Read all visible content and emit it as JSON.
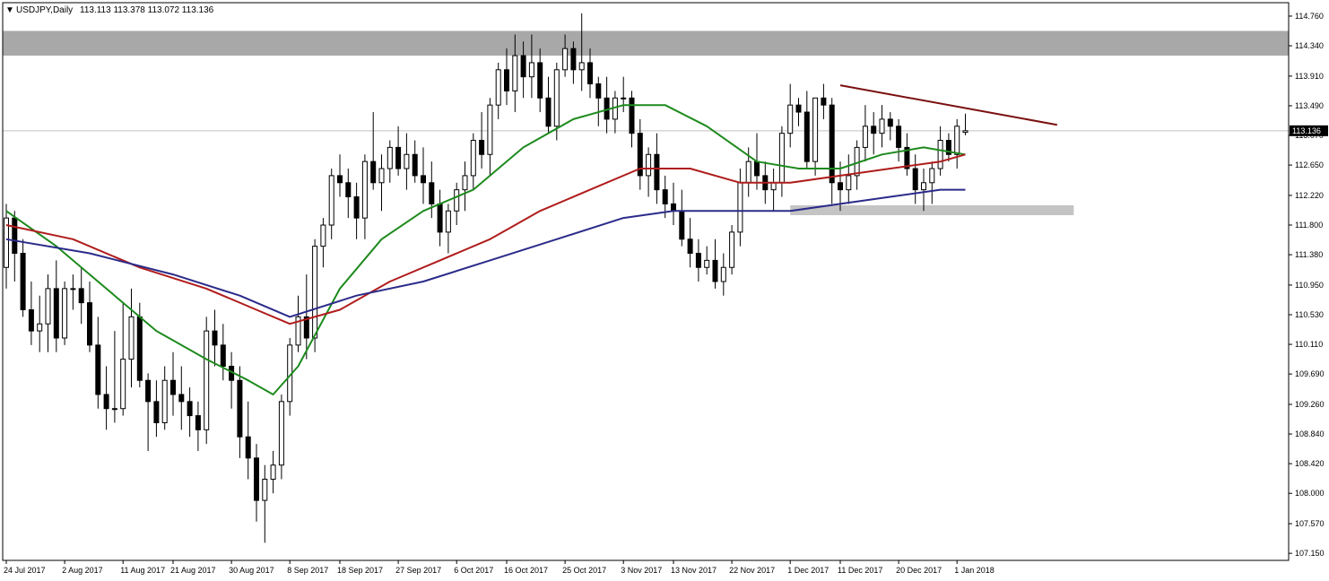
{
  "header": {
    "symbol_label": "USDJPY,Daily",
    "ohlc_label": "113.113 113.378 113.072 113.136"
  },
  "colors": {
    "background": "#ffffff",
    "candle_up_body": "#ffffff",
    "candle_down_body": "#000000",
    "candle_outline": "#000000",
    "ma_fast": "#1d8a1d",
    "ma_mid": "#b01c1c",
    "ma_slow": "#2b2b8a",
    "resistance_zone": "#a8a8a8",
    "support_zone": "#c4c4c4",
    "trendline": "#7a0f0f",
    "current_price_line": "#c0c0c0",
    "price_box": "#000000"
  },
  "chart_data": {
    "type": "candlestick",
    "symbol": "USDJPY",
    "timeframe": "Daily",
    "current_price": 113.136,
    "ohlc_last": {
      "open": 113.113,
      "high": 113.378,
      "low": 113.072,
      "close": 113.136
    },
    "ylim": [
      107.05,
      114.95
    ],
    "y_ticks": [
      "114.760",
      "114.340",
      "113.910",
      "113.490",
      "113.070",
      "112.650",
      "112.220",
      "111.800",
      "111.380",
      "110.950",
      "110.530",
      "110.110",
      "109.690",
      "109.260",
      "108.840",
      "108.420",
      "108.000",
      "107.570",
      "107.150"
    ],
    "x_ticks": [
      {
        "label": "24 Jul 2017",
        "index": 0
      },
      {
        "label": "2 Aug 2017",
        "index": 7
      },
      {
        "label": "11 Aug 2017",
        "index": 14
      },
      {
        "label": "21 Aug 2017",
        "index": 20
      },
      {
        "label": "30 Aug 2017",
        "index": 27
      },
      {
        "label": "8 Sep 2017",
        "index": 34
      },
      {
        "label": "18 Sep 2017",
        "index": 40
      },
      {
        "label": "27 Sep 2017",
        "index": 47
      },
      {
        "label": "6 Oct 2017",
        "index": 54
      },
      {
        "label": "16 Oct 2017",
        "index": 60
      },
      {
        "label": "25 Oct 2017",
        "index": 67
      },
      {
        "label": "3 Nov 2017",
        "index": 74
      },
      {
        "label": "13 Nov 2017",
        "index": 80
      },
      {
        "label": "22 Nov 2017",
        "index": 87
      },
      {
        "label": "1 Dec 2017",
        "index": 94
      },
      {
        "label": "11 Dec 2017",
        "index": 100
      },
      {
        "label": "20 Dec 2017",
        "index": 107
      },
      {
        "label": "1 Jan 2018",
        "index": 114
      }
    ],
    "candles": [
      [
        111.2,
        112.1,
        110.9,
        111.9
      ],
      [
        111.9,
        112.0,
        111.0,
        111.4
      ],
      [
        111.4,
        111.6,
        110.5,
        110.6
      ],
      [
        110.6,
        111.0,
        110.1,
        110.3
      ],
      [
        110.3,
        110.8,
        110.0,
        110.4
      ],
      [
        110.4,
        111.1,
        110.0,
        110.9
      ],
      [
        110.9,
        111.3,
        110.0,
        110.2
      ],
      [
        110.2,
        111.0,
        110.1,
        110.9
      ],
      [
        110.9,
        111.1,
        110.6,
        110.9
      ],
      [
        110.9,
        111.2,
        110.4,
        110.7
      ],
      [
        110.7,
        111.0,
        110.0,
        110.1
      ],
      [
        110.1,
        110.5,
        109.2,
        109.4
      ],
      [
        109.4,
        109.8,
        108.9,
        109.2
      ],
      [
        109.2,
        110.3,
        109.0,
        109.2
      ],
      [
        109.2,
        110.7,
        109.1,
        109.9
      ],
      [
        109.9,
        110.9,
        109.5,
        110.5
      ],
      [
        110.5,
        110.7,
        109.5,
        109.6
      ],
      [
        109.6,
        109.7,
        108.6,
        109.3
      ],
      [
        109.3,
        109.6,
        108.8,
        109.0
      ],
      [
        109.0,
        109.8,
        108.9,
        109.6
      ],
      [
        109.6,
        110.0,
        109.1,
        109.4
      ],
      [
        109.4,
        109.8,
        108.9,
        109.3
      ],
      [
        109.3,
        109.5,
        108.8,
        109.1
      ],
      [
        109.1,
        109.3,
        108.6,
        108.9
      ],
      [
        108.9,
        110.5,
        108.7,
        110.3
      ],
      [
        110.3,
        110.6,
        109.8,
        110.1
      ],
      [
        110.1,
        110.4,
        109.6,
        109.8
      ],
      [
        109.8,
        110.0,
        109.2,
        109.6
      ],
      [
        109.6,
        109.8,
        108.5,
        108.8
      ],
      [
        108.8,
        109.3,
        108.2,
        108.5
      ],
      [
        108.5,
        108.7,
        107.6,
        107.9
      ],
      [
        107.9,
        108.4,
        107.3,
        108.2
      ],
      [
        108.2,
        108.6,
        108.0,
        108.4
      ],
      [
        108.4,
        109.4,
        108.2,
        109.3
      ],
      [
        109.3,
        110.2,
        109.1,
        110.1
      ],
      [
        110.1,
        110.8,
        110.0,
        110.5
      ],
      [
        110.5,
        111.1,
        109.9,
        110.2
      ],
      [
        110.2,
        111.6,
        110.0,
        111.5
      ],
      [
        111.5,
        111.9,
        111.2,
        111.8
      ],
      [
        111.8,
        112.6,
        111.6,
        112.5
      ],
      [
        112.5,
        112.8,
        112.2,
        112.4
      ],
      [
        112.4,
        112.6,
        111.9,
        112.2
      ],
      [
        112.2,
        112.4,
        111.6,
        111.9
      ],
      [
        111.9,
        112.8,
        111.6,
        112.7
      ],
      [
        112.7,
        113.4,
        112.3,
        112.4
      ],
      [
        112.4,
        112.8,
        112.0,
        112.6
      ],
      [
        112.6,
        113.0,
        112.4,
        112.9
      ],
      [
        112.9,
        113.2,
        112.5,
        112.6
      ],
      [
        112.6,
        113.1,
        112.3,
        112.8
      ],
      [
        112.8,
        113.0,
        112.4,
        112.5
      ],
      [
        112.5,
        112.9,
        112.1,
        112.4
      ],
      [
        112.4,
        112.7,
        111.9,
        112.1
      ],
      [
        112.1,
        112.3,
        111.5,
        111.7
      ],
      [
        111.7,
        112.1,
        111.4,
        112.0
      ],
      [
        112.0,
        112.4,
        111.8,
        112.3
      ],
      [
        112.3,
        112.7,
        112.0,
        112.5
      ],
      [
        112.5,
        113.1,
        112.3,
        113.0
      ],
      [
        113.0,
        113.4,
        112.6,
        112.8
      ],
      [
        112.8,
        113.6,
        112.5,
        113.5
      ],
      [
        113.5,
        114.1,
        113.3,
        114.0
      ],
      [
        114.0,
        114.3,
        113.5,
        113.7
      ],
      [
        113.7,
        114.5,
        113.4,
        114.2
      ],
      [
        114.2,
        114.4,
        113.6,
        113.9
      ],
      [
        113.9,
        114.5,
        113.6,
        114.1
      ],
      [
        114.1,
        114.3,
        113.4,
        113.6
      ],
      [
        113.6,
        113.9,
        113.1,
        113.2
      ],
      [
        113.2,
        114.1,
        113.0,
        114.0
      ],
      [
        114.0,
        114.5,
        113.9,
        114.3
      ],
      [
        114.3,
        114.4,
        113.8,
        114.0
      ],
      [
        114.0,
        114.8,
        113.7,
        114.1
      ],
      [
        114.1,
        114.3,
        113.6,
        113.8
      ],
      [
        113.8,
        113.9,
        113.2,
        113.6
      ],
      [
        113.6,
        113.9,
        113.1,
        113.3
      ],
      [
        113.3,
        113.7,
        113.1,
        113.6
      ],
      [
        113.6,
        113.9,
        113.4,
        113.6
      ],
      [
        113.6,
        113.7,
        112.9,
        113.1
      ],
      [
        113.1,
        113.3,
        112.3,
        112.5
      ],
      [
        112.5,
        112.9,
        112.2,
        112.8
      ],
      [
        112.8,
        113.1,
        112.1,
        112.3
      ],
      [
        112.3,
        112.5,
        111.9,
        112.1
      ],
      [
        112.1,
        112.4,
        111.8,
        112.0
      ],
      [
        112.0,
        112.3,
        111.5,
        111.6
      ],
      [
        111.6,
        111.9,
        111.2,
        111.4
      ],
      [
        111.4,
        111.6,
        111.0,
        111.2
      ],
      [
        111.2,
        111.5,
        111.1,
        111.3
      ],
      [
        111.3,
        111.6,
        110.9,
        111.0
      ],
      [
        111.0,
        111.4,
        110.8,
        111.2
      ],
      [
        111.2,
        111.8,
        111.1,
        111.7
      ],
      [
        111.7,
        112.6,
        111.5,
        112.4
      ],
      [
        112.4,
        112.9,
        112.2,
        112.7
      ],
      [
        112.7,
        113.1,
        112.3,
        112.5
      ],
      [
        112.5,
        112.7,
        112.1,
        112.3
      ],
      [
        112.3,
        112.6,
        112.0,
        112.4
      ],
      [
        112.4,
        113.2,
        112.2,
        113.1
      ],
      [
        113.1,
        113.8,
        112.9,
        113.5
      ],
      [
        113.5,
        113.6,
        113.2,
        113.4
      ],
      [
        113.4,
        113.7,
        112.6,
        112.7
      ],
      [
        112.7,
        113.6,
        112.5,
        113.6
      ],
      [
        113.6,
        113.8,
        113.3,
        113.5
      ],
      [
        113.5,
        113.6,
        112.1,
        112.4
      ],
      [
        112.4,
        112.7,
        112.0,
        112.3
      ],
      [
        112.3,
        112.8,
        112.1,
        112.5
      ],
      [
        112.5,
        113.0,
        112.3,
        112.9
      ],
      [
        112.9,
        113.5,
        112.7,
        113.2
      ],
      [
        113.2,
        113.4,
        112.8,
        113.1
      ],
      [
        113.1,
        113.5,
        112.9,
        113.3
      ],
      [
        113.3,
        113.4,
        113.0,
        113.2
      ],
      [
        113.2,
        113.3,
        112.7,
        112.9
      ],
      [
        112.9,
        113.1,
        112.5,
        112.6
      ],
      [
        112.6,
        112.8,
        112.1,
        112.3
      ],
      [
        112.3,
        112.6,
        112.0,
        112.4
      ],
      [
        112.4,
        112.7,
        112.1,
        112.6
      ],
      [
        112.6,
        113.2,
        112.5,
        113.0
      ],
      [
        113.0,
        113.1,
        112.7,
        112.8
      ],
      [
        112.8,
        113.3,
        112.6,
        113.2
      ],
      [
        113.113,
        113.378,
        113.072,
        113.136
      ]
    ],
    "series": [
      {
        "type": "line",
        "color": "#1d8a1d",
        "points": [
          [
            0,
            112.0
          ],
          [
            6,
            111.5
          ],
          [
            12,
            110.9
          ],
          [
            18,
            110.3
          ],
          [
            24,
            109.9
          ],
          [
            29,
            109.6
          ],
          [
            32,
            109.4
          ],
          [
            35,
            109.8
          ],
          [
            40,
            110.9
          ],
          [
            45,
            111.6
          ],
          [
            50,
            112.0
          ],
          [
            56,
            112.3
          ],
          [
            62,
            112.9
          ],
          [
            68,
            113.3
          ],
          [
            74,
            113.5
          ],
          [
            79,
            113.5
          ],
          [
            84,
            113.2
          ],
          [
            90,
            112.7
          ],
          [
            95,
            112.6
          ],
          [
            100,
            112.6
          ],
          [
            105,
            112.8
          ],
          [
            110,
            112.9
          ],
          [
            115,
            112.8
          ]
        ]
      },
      {
        "type": "line",
        "color": "#b01c1c",
        "points": [
          [
            0,
            111.8
          ],
          [
            8,
            111.6
          ],
          [
            16,
            111.2
          ],
          [
            24,
            110.9
          ],
          [
            30,
            110.6
          ],
          [
            34,
            110.4
          ],
          [
            40,
            110.6
          ],
          [
            46,
            111.0
          ],
          [
            52,
            111.3
          ],
          [
            58,
            111.6
          ],
          [
            64,
            112.0
          ],
          [
            70,
            112.3
          ],
          [
            76,
            112.6
          ],
          [
            82,
            112.6
          ],
          [
            88,
            112.4
          ],
          [
            94,
            112.4
          ],
          [
            100,
            112.5
          ],
          [
            106,
            112.6
          ],
          [
            112,
            112.7
          ],
          [
            115,
            112.8
          ]
        ]
      },
      {
        "type": "line",
        "color": "#2b2b8a",
        "points": [
          [
            0,
            111.6
          ],
          [
            10,
            111.4
          ],
          [
            20,
            111.1
          ],
          [
            28,
            110.8
          ],
          [
            34,
            110.5
          ],
          [
            42,
            110.8
          ],
          [
            50,
            111.0
          ],
          [
            58,
            111.3
          ],
          [
            66,
            111.6
          ],
          [
            74,
            111.9
          ],
          [
            80,
            112.0
          ],
          [
            88,
            112.0
          ],
          [
            94,
            112.0
          ],
          [
            100,
            112.1
          ],
          [
            106,
            112.2
          ],
          [
            112,
            112.3
          ],
          [
            115,
            112.3
          ]
        ]
      }
    ],
    "resistance_zone": {
      "y_low": 114.2,
      "y_high": 114.55,
      "x_start_index": 0,
      "x_end_index": "right-edge"
    },
    "support_zone": {
      "y_low": 111.94,
      "y_high": 112.08,
      "x_start_index": 94,
      "x_end_index": 128
    },
    "trendline": {
      "from": [
        100,
        113.78
      ],
      "to": [
        126,
        113.22
      ]
    }
  }
}
